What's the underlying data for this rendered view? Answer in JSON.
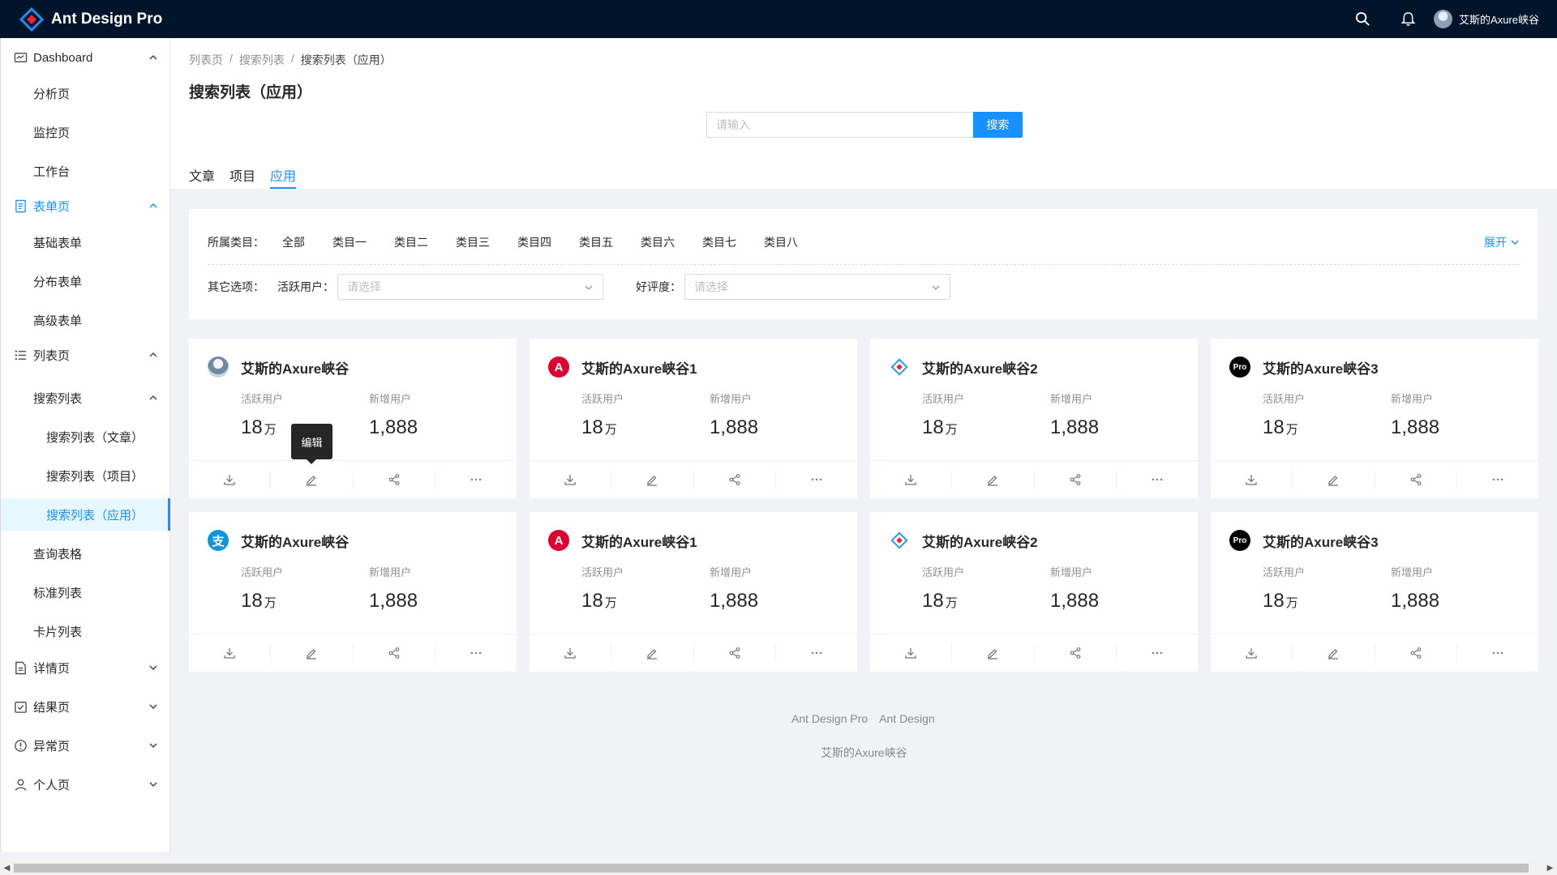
{
  "app": {
    "title": "Ant Design Pro"
  },
  "header": {
    "user_name": "艾斯的Axure峡谷"
  },
  "sidebar": {
    "items": [
      {
        "label": "Dashboard"
      },
      {
        "label": "分析页"
      },
      {
        "label": "监控页"
      },
      {
        "label": "工作台"
      },
      {
        "label": "表单页"
      },
      {
        "label": "基础表单"
      },
      {
        "label": "分布表单"
      },
      {
        "label": "高级表单"
      },
      {
        "label": "列表页"
      },
      {
        "label": "搜索列表"
      },
      {
        "label": "搜索列表（文章）"
      },
      {
        "label": "搜索列表（项目）"
      },
      {
        "label": "搜索列表（应用）"
      },
      {
        "label": "查询表格"
      },
      {
        "label": "标准列表"
      },
      {
        "label": "卡片列表"
      },
      {
        "label": "详情页"
      },
      {
        "label": "结果页"
      },
      {
        "label": "异常页"
      },
      {
        "label": "个人页"
      }
    ]
  },
  "breadcrumb": {
    "items": [
      "列表页",
      "搜索列表",
      "搜索列表（应用）"
    ],
    "separator": "/"
  },
  "page": {
    "title": "搜索列表（应用）"
  },
  "search": {
    "placeholder": "请输入",
    "button": "搜索"
  },
  "tabs": [
    {
      "label": "文章"
    },
    {
      "label": "项目"
    },
    {
      "label": "应用"
    }
  ],
  "filter": {
    "category_label": "所属类目：",
    "categories": [
      "全部",
      "类目一",
      "类目二",
      "类目三",
      "类目四",
      "类目五",
      "类目六",
      "类目七",
      "类目八"
    ],
    "expand": "展开",
    "other_label": "其它选项：",
    "active_users_label": "活跃用户：",
    "active_users_placeholder": "请选择",
    "rating_label": "好评度：",
    "rating_placeholder": "请选择"
  },
  "cards": [
    {
      "title": "艾斯的Axure峡谷",
      "logo": "avatar-photo",
      "active_label": "活跃用户",
      "active_value": "18",
      "active_unit": "万",
      "new_label": "新增用户",
      "new_value": "1,888"
    },
    {
      "title": "艾斯的Axure峡谷1",
      "logo": "angular-logo",
      "active_label": "活跃用户",
      "active_value": "18",
      "active_unit": "万",
      "new_label": "新增用户",
      "new_value": "1,888"
    },
    {
      "title": "艾斯的Axure峡谷2",
      "logo": "ant-design-logo",
      "active_label": "活跃用户",
      "active_value": "18",
      "active_unit": "万",
      "new_label": "新增用户",
      "new_value": "1,888"
    },
    {
      "title": "艾斯的Axure峡谷3",
      "logo": "pro-logo",
      "logo_text": "Pro",
      "active_label": "活跃用户",
      "active_value": "18",
      "active_unit": "万",
      "new_label": "新增用户",
      "new_value": "1,888"
    },
    {
      "title": "艾斯的Axure峡谷",
      "logo": "alipay-logo",
      "logo_text": "支",
      "active_label": "活跃用户",
      "active_value": "18",
      "active_unit": "万",
      "new_label": "新增用户",
      "new_value": "1,888"
    },
    {
      "title": "艾斯的Axure峡谷1",
      "logo": "angular-logo",
      "active_label": "活跃用户",
      "active_value": "18",
      "active_unit": "万",
      "new_label": "新增用户",
      "new_value": "1,888"
    },
    {
      "title": "艾斯的Axure峡谷2",
      "logo": "ant-design-logo",
      "active_label": "活跃用户",
      "active_value": "18",
      "active_unit": "万",
      "new_label": "新增用户",
      "new_value": "1,888"
    },
    {
      "title": "艾斯的Axure峡谷3",
      "logo": "pro-logo",
      "logo_text": "Pro",
      "active_label": "活跃用户",
      "active_value": "18",
      "active_unit": "万",
      "new_label": "新增用户",
      "new_value": "1,888"
    }
  ],
  "tooltip": {
    "text": "编辑"
  },
  "footer": {
    "links": [
      "Ant Design Pro",
      "Ant Design"
    ],
    "copyright": "艾斯的Axure峡谷"
  },
  "colors": {
    "header_bg": "#001529",
    "primary": "#1890ff",
    "angular_red": "#dd0031",
    "page_bg": "#f0f2f5"
  }
}
